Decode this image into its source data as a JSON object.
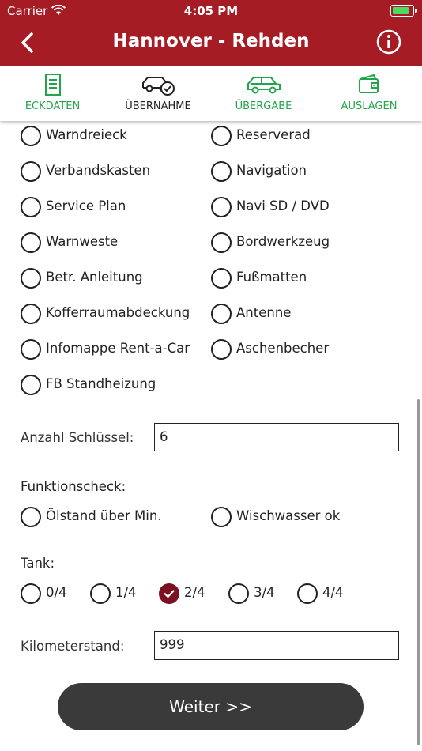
{
  "status_bar": {
    "carrier": "Carrier",
    "time": "4:05 PM"
  },
  "header": {
    "title": "Hannover - Rehden"
  },
  "tabs": [
    {
      "label": "ECKDATEN",
      "icon": "document-icon",
      "color": "#23a34a"
    },
    {
      "label": "ÜBERNAHME",
      "icon": "car-check-icon",
      "color": "#222222"
    },
    {
      "label": "ÜBERGABE",
      "icon": "car-icon",
      "color": "#23a34a"
    },
    {
      "label": "AUSLAGEN",
      "icon": "wallet-icon",
      "color": "#23a34a"
    }
  ],
  "equipment": {
    "left": [
      "Warndreieck",
      "Verbandskasten",
      "Service Plan",
      "Warnweste",
      "Betr. Anleitung",
      "Kofferraumabdeckung",
      "Infomappe Rent-a-Car",
      "FB Standheizung"
    ],
    "right": [
      "Reserverad",
      "Navigation",
      "Navi SD / DVD",
      "Bordwerkzeug",
      "Fußmatten",
      "Antenne",
      "Aschenbecher"
    ]
  },
  "keys": {
    "label": "Anzahl Schlüssel:",
    "value": "6"
  },
  "function_check": {
    "label": "Funktionscheck:",
    "items": [
      "Ölstand über Min.",
      "Wischwasser ok"
    ]
  },
  "tank": {
    "label": "Tank:",
    "options": [
      "0/4",
      "1/4",
      "2/4",
      "3/4",
      "4/4"
    ],
    "selected": "2/4"
  },
  "mileage": {
    "label": "Kilometerstand:",
    "value": "999"
  },
  "submit": {
    "label": "Weiter >>"
  },
  "colors": {
    "header": "#a51c24",
    "accent_green": "#23a34a",
    "checked": "#7d1020"
  }
}
